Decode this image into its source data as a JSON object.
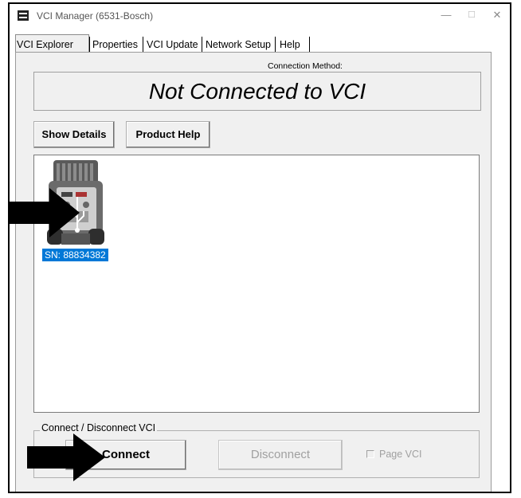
{
  "window": {
    "title": "VCI Manager (6531-Bosch)",
    "controls": {
      "minimize": "—",
      "maximize": "☐",
      "close": "✕"
    }
  },
  "tabs": [
    {
      "label": "VCI Explorer",
      "active": true
    },
    {
      "label": "Properties",
      "active": false
    },
    {
      "label": "VCI Update",
      "active": false
    },
    {
      "label": "Network Setup",
      "active": false
    },
    {
      "label": "Help",
      "active": false
    }
  ],
  "connection": {
    "method_label": "Connection Method:",
    "status": "Not Connected to VCI"
  },
  "buttons": {
    "show_details": "Show Details",
    "product_help": "Product Help"
  },
  "device_list": {
    "devices": [
      {
        "serial_label": "SN: 88834382",
        "icon": "vci-device-icon",
        "selected": true
      }
    ]
  },
  "connect_group": {
    "title": "Connect / Disconnect VCI",
    "connect": "Connect",
    "disconnect": "Disconnect",
    "disconnect_enabled": false,
    "page_vci": "Page VCI",
    "page_vci_checked": false
  },
  "colors": {
    "selection": "#0078d7",
    "panel_bg": "#f0f0f0",
    "disabled_text": "#a0a0a0"
  }
}
